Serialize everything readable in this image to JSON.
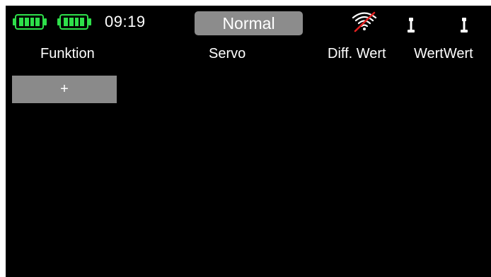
{
  "status_bar": {
    "time": "09:19",
    "mode_label": "Normal",
    "battery_color": "#2ee04a",
    "signal_icon": "wifi-off-icon",
    "stick_icon": "stick-icon"
  },
  "columns": {
    "function": "Funktion",
    "servo": "Servo",
    "diff_value": "Diff. Wert",
    "value": "WertWert"
  },
  "add_button": {
    "label": "+"
  }
}
